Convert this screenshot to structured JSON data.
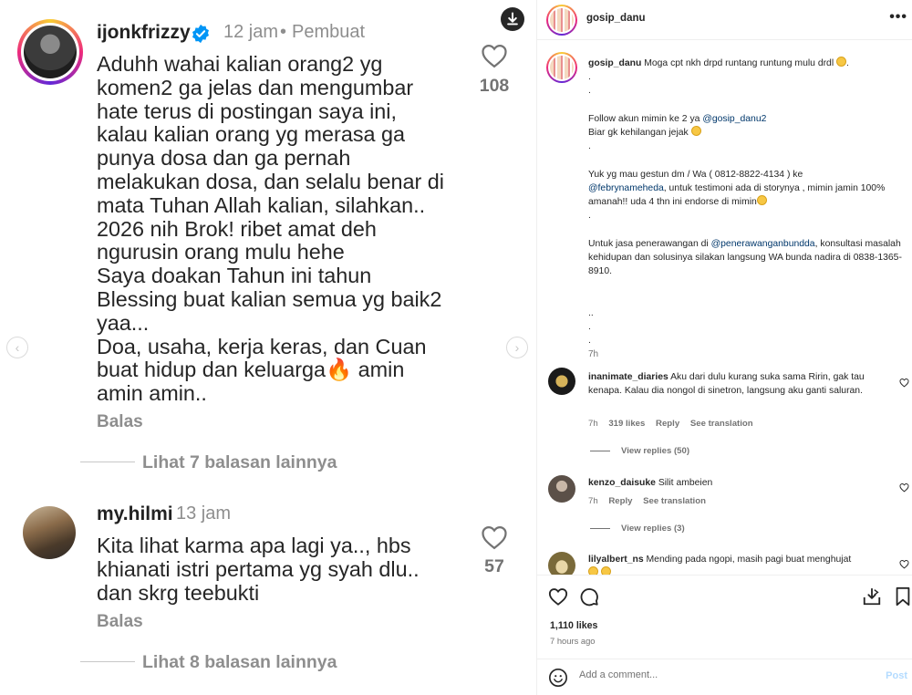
{
  "media": {
    "comment1": {
      "username": "ijonkfrizzy",
      "time": "12 jam",
      "separator": "•",
      "role": "Pembuat",
      "text": "Aduhh wahai kalian orang2 yg\nkomen2 ga jelas dan mengumbar\nhate terus di postingan saya ini,\nkalau kalian orang yg merasa ga\npunya dosa dan ga pernah\nmelakukan dosa, dan selalu benar di\nmata Tuhan Allah kalian, silahkan..\n2026 nih Brok! ribet amat deh\nngurusin orang mulu hehe\nSaya doakan Tahun ini tahun\nBlessing buat kalian semua yg baik2\nyaa...\nDoa, usaha, kerja keras, dan Cuan\nbuat hidup dan keluarga🔥 amin\namin amin..",
      "likes": "108",
      "reply_label": "Balas",
      "more_replies": "Lihat 7 balasan lainnya"
    },
    "comment2": {
      "username": "my.hilmi",
      "time": "13 jam",
      "text": "Kita lihat karma apa lagi ya.., hbs\nkhianati istri pertama yg syah dlu..\ndan skrg teebukti",
      "likes": "57",
      "reply_label": "Balas",
      "more_replies": "Lihat 8 balasan lainnya"
    },
    "nav_prev": "‹",
    "nav_next": "›"
  },
  "post": {
    "username": "gosip_danu",
    "more_label": "•••",
    "caption": {
      "username": "gosip_danu",
      "line1": "Moga cpt nkh drpd runtang runtung mulu drdl",
      "dot": ".",
      "follow": "Follow akun mimin ke 2 ya",
      "follow_mention": "@gosip_danu2",
      "follow2": "Biar gk kehilangan jejak",
      "gestun1": "Yuk yg mau gestun dm / Wa ( 0812-8822-4134 ) ke",
      "gestun_mention": "@febrynameheda",
      "gestun2": ", untuk testimoni ada di storynya , mimin jamin 100% amanah!! uda 4 thn ini endorse di mimin",
      "jasa1": "Untuk jasa penerawangan di",
      "jasa_mention": "@penerawanganbundda",
      "jasa2": ", konsultasi masalah kehidupan dan solusinya silakan langsung WA bunda nadira di 0838-1365-8910.",
      "dots2": "..",
      "time": "7h"
    },
    "comments": [
      {
        "username": "inanimate_diaries",
        "text": "Aku dari dulu kurang suka sama Ririn, gak tau kenapa. Kalau dia nongol di sinetron, langsung aku ganti saluran.",
        "time": "7h",
        "likes": "319 likes",
        "reply": "Reply",
        "translate": "See translation",
        "view_replies": "View replies (50)"
      },
      {
        "username": "kenzo_daisuke",
        "text": "Silit ambeien",
        "time": "7h",
        "reply": "Reply",
        "translate": "See translation",
        "view_replies": "View replies (3)"
      },
      {
        "username": "lilyalbert_ns",
        "text": "Mending pada ngopi, masih pagi buat menghujat"
      }
    ],
    "likes_count": "1,110 likes",
    "time_ago": "7 hours ago",
    "add_comment_placeholder": "Add a comment...",
    "post_label": "Post"
  },
  "colors": {
    "mention": "#00376b",
    "post_disabled": "#b3dbff",
    "muted": "#737373"
  }
}
